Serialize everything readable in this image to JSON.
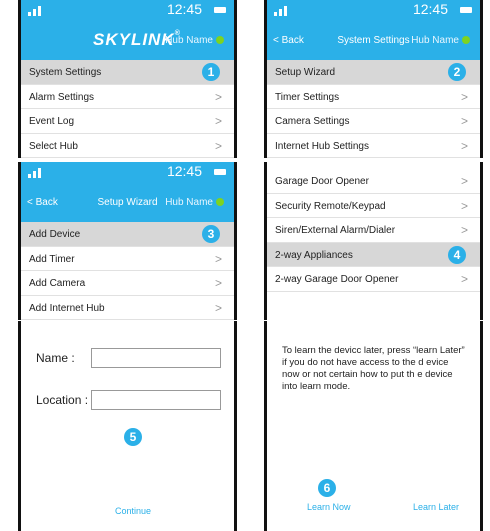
{
  "status": {
    "time": "12:45"
  },
  "hub_name": "Hub Name",
  "logo": {
    "text": "SKYLINK",
    "mark": "®"
  },
  "back_label": "Back",
  "panel1": {
    "step": "1",
    "items": [
      "System Settings",
      "Alarm Settings",
      "Event Log",
      "Select Hub"
    ]
  },
  "panel2": {
    "title": "System Settings",
    "step": "2",
    "items": [
      "Setup Wizard",
      "Timer Settings",
      "Camera Settings",
      "Internet Hub Settings"
    ]
  },
  "panel3": {
    "title": "Setup Wizard",
    "step": "3",
    "items": [
      "Add Device",
      "Add Timer",
      "Add Camera",
      "Add Internet Hub"
    ]
  },
  "panel4": {
    "step": "4",
    "items": [
      "Garage Door Opener",
      "Security Remote/Keypad",
      "Siren/External Alarm/Dialer",
      "2-way Appliances",
      "2-way Garage Door Opener"
    ]
  },
  "panel5": {
    "name_label": "Name :",
    "location_label": "Location :",
    "step": "5",
    "continue_label": "Continue"
  },
  "panel6": {
    "text": "To learn the devicc later, press “learn Later” if you do not have access to the d evice now or not certain how to put th e device into learn mode.",
    "step": "6",
    "learn_now": "Learn Now",
    "learn_later": "Learn Later"
  },
  "colors": {
    "accent": "#2bb0e8",
    "selected_row": "#d7d7d7",
    "status_dot": "#7ed321"
  }
}
